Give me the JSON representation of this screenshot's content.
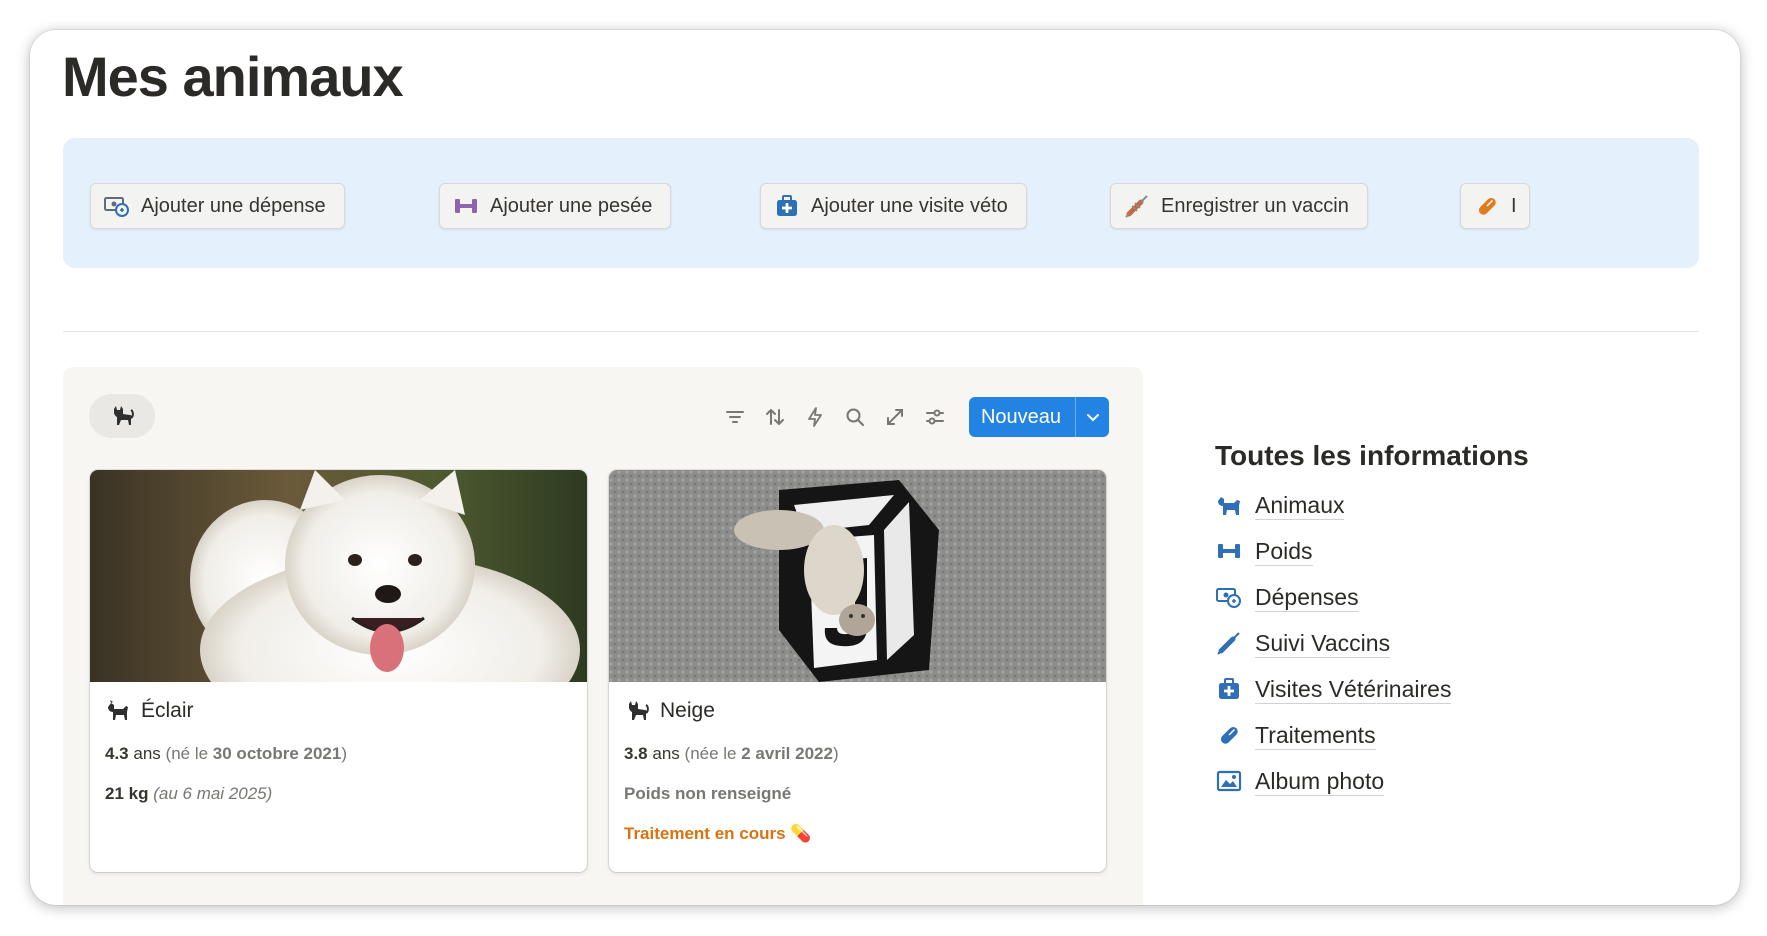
{
  "page": {
    "title": "Mes animaux"
  },
  "quick_actions": [
    {
      "label": "Ajouter une dépense",
      "icon": "money-exchange-icon"
    },
    {
      "label": "Ajouter une pesée",
      "icon": "dumbbell-icon"
    },
    {
      "label": "Ajouter une visite véto",
      "icon": "medical-bag-icon"
    },
    {
      "label": "Enregistrer un vaccin",
      "icon": "syringe-icon"
    },
    {
      "label": "I",
      "icon": "pill-icon"
    }
  ],
  "board": {
    "view_icon": "cat-icon",
    "toolbar_icons": [
      "filter-icon",
      "sort-icon",
      "lightning-icon",
      "search-icon",
      "expand-icon",
      "settings-sliders-icon"
    ],
    "new_button_label": "Nouveau",
    "cards": [
      {
        "name": "Éclair",
        "icon": "dog-icon",
        "age": "4.3",
        "age_unit": "ans",
        "birth_prefix": "(né le",
        "birth_date": "30 octobre 2021",
        "birth_suffix": ")",
        "weight": "21 kg",
        "weight_note": "(au 6 mai 2025)"
      },
      {
        "name": "Neige",
        "icon": "cat-icon",
        "age": "3.8",
        "age_unit": "ans",
        "birth_prefix": "(née le",
        "birth_date": "2 avril 2022",
        "birth_suffix": ")",
        "weight_status": "Poids non renseigné",
        "treatment": "Traitement en cours 💊"
      }
    ]
  },
  "aside": {
    "title": "Toutes les informations",
    "links": [
      {
        "label": "Animaux",
        "icon": "dog-icon"
      },
      {
        "label": "Poids",
        "icon": "dumbbell-icon"
      },
      {
        "label": "Dépenses",
        "icon": "money-exchange-icon"
      },
      {
        "label": "Suivi Vaccins",
        "icon": "syringe-icon"
      },
      {
        "label": "Visites Vétérinaires",
        "icon": "medical-bag-icon"
      },
      {
        "label": "Traitements",
        "icon": "pill-icon"
      },
      {
        "label": "Album photo",
        "icon": "image-icon"
      }
    ]
  },
  "colors": {
    "accent": "#2383e2",
    "callout_bg": "#e4f0fb",
    "warning": "#d9730d"
  }
}
